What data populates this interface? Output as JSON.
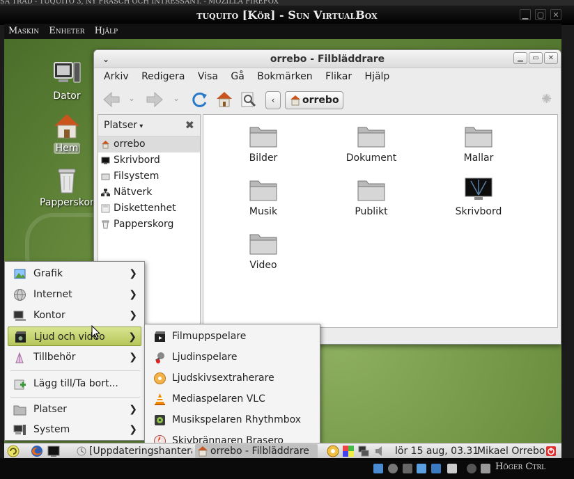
{
  "host": {
    "top_text": "SA TRÅD - TUQUITO 3, NY FRÄSCH OCH INTRESSANT. - MOZILLA FIREFOX",
    "vbox_title": "tuquito [Kör] - Sun VirtualBox",
    "vbox_menu": [
      "Maskin",
      "Enheter",
      "Hjälp"
    ],
    "host_key_label": "Höger Ctrl"
  },
  "desktop": {
    "icons": [
      {
        "label": "Dator",
        "icon": "computer-icon"
      },
      {
        "label": "Hem",
        "icon": "home-icon"
      },
      {
        "label": "Papperskorg",
        "icon": "trash-icon"
      }
    ]
  },
  "file_manager": {
    "title": "orrebo - Filbläddrare",
    "menu": [
      "Arkiv",
      "Redigera",
      "Visa",
      "Gå",
      "Bokmärken",
      "Flikar",
      "Hjälp"
    ],
    "location": "orrebo",
    "sidebar": {
      "header": "Platser",
      "items": [
        "orrebo",
        "Skrivbord",
        "Filsystem",
        "Nätverk",
        "Diskettenhet",
        "Papperskorg"
      ]
    },
    "files": [
      "Bilder",
      "Dokument",
      "Mallar",
      "Musik",
      "Publikt",
      "Skrivbord",
      "Video"
    ]
  },
  "app_menu": {
    "items": [
      "Grafik",
      "Internet",
      "Kontor",
      "Ljud och video",
      "Tillbehör",
      "Lägg till/Ta bort...",
      "Platser",
      "System"
    ],
    "submenu": [
      "Filmuppspelare",
      "Ljudinspelare",
      "Ljudskivsextraherare",
      "Mediaspelaren VLC",
      "Musikspelaren Rhythmbox",
      "Skivbrännaren Brasero"
    ]
  },
  "panel": {
    "tasks": [
      "[Uppdateringshanterare]",
      "orrebo - Filbläddrare"
    ],
    "clock": "lör 15 aug, 03.31",
    "user": "Mikael Orrebo"
  },
  "colors": {
    "menu_highlight": "#c4d46f",
    "desktop_green": "#6d9141"
  }
}
